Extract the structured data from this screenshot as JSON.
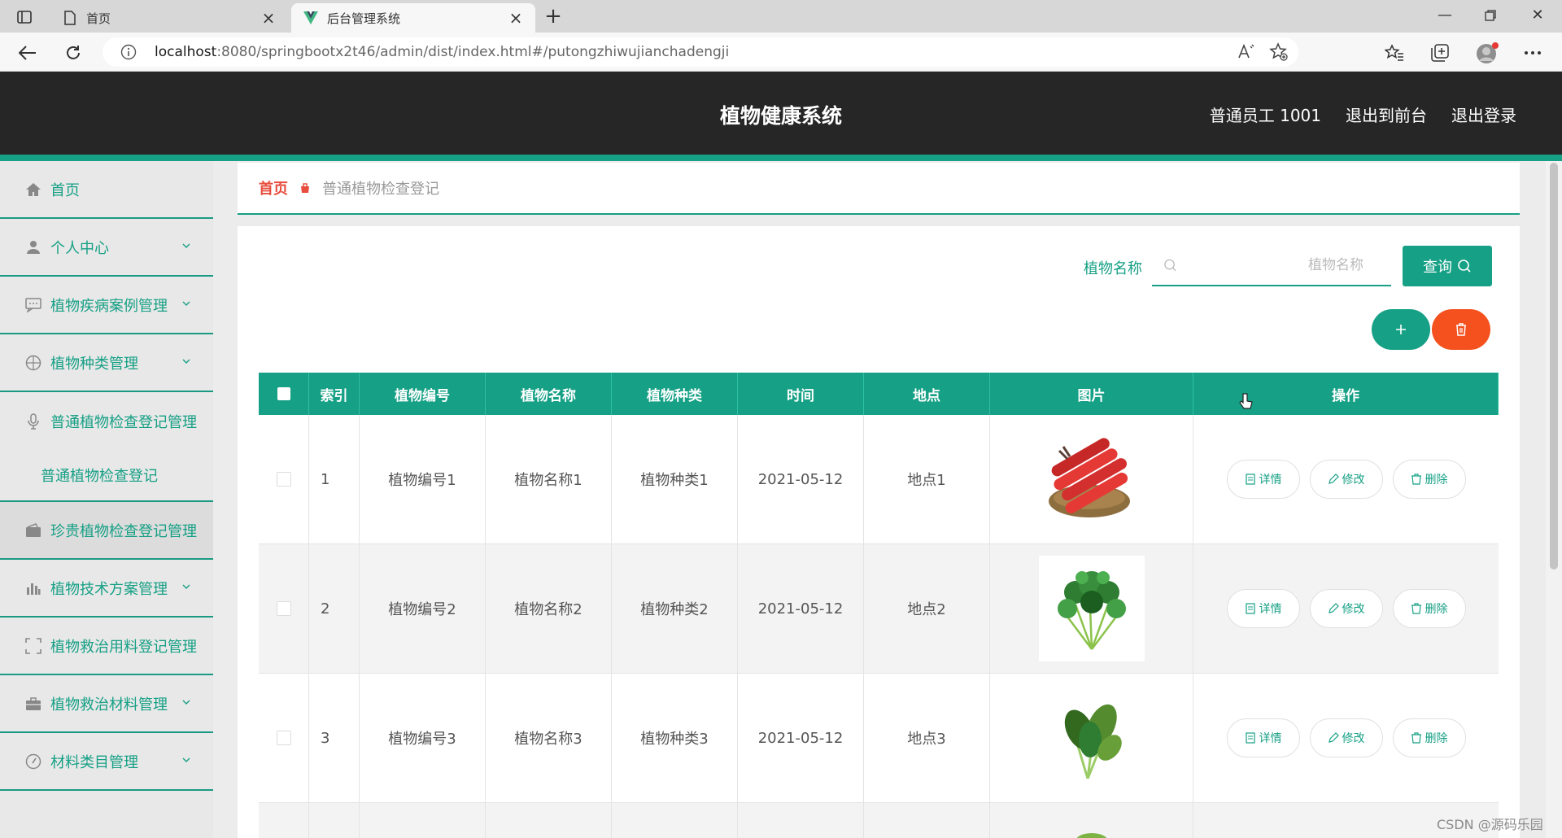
{
  "browser": {
    "tabs": [
      {
        "title": "首页",
        "active": false
      },
      {
        "title": "后台管理系统",
        "active": true
      }
    ],
    "url_host": "localhost",
    "url_path": ":8080/springbootx2t46/admin/dist/index.html#/putongzhiwujianchadengji"
  },
  "header": {
    "title": "植物健康系统",
    "user": "普通员工 1001",
    "to_front": "退出到前台",
    "logout": "退出登录"
  },
  "sidebar": {
    "items": [
      {
        "label": "首页",
        "icon": "home-icon"
      },
      {
        "label": "个人中心",
        "icon": "user-icon"
      },
      {
        "label": "植物疾病案例管理",
        "icon": "message-icon"
      },
      {
        "label": "植物种类管理",
        "icon": "compass-icon"
      },
      {
        "label": "普通植物检查登记管理",
        "icon": "mic-icon",
        "submenu": "普通植物检查登记"
      },
      {
        "label": "珍贵植物检查登记管理",
        "icon": "wallet-icon"
      },
      {
        "label": "植物技术方案管理",
        "icon": "chart-icon"
      },
      {
        "label": "植物救治用料登记管理",
        "icon": "frame-icon"
      },
      {
        "label": "植物救治材料管理",
        "icon": "briefcase-icon"
      },
      {
        "label": "材料类目管理",
        "icon": "clock-icon"
      }
    ]
  },
  "breadcrumb": {
    "home": "首页",
    "current": "普通植物检查登记"
  },
  "search": {
    "label": "植物名称",
    "placeholder": "植物名称",
    "query_label": "查询"
  },
  "table": {
    "headers": [
      "索引",
      "植物编号",
      "植物名称",
      "植物种类",
      "时间",
      "地点",
      "图片",
      "操作"
    ],
    "rows": [
      {
        "index": "1",
        "code": "植物编号1",
        "name": "植物名称1",
        "kind": "植物种类1",
        "date": "2021-05-12",
        "place": "地点1",
        "image": "carrots"
      },
      {
        "index": "2",
        "code": "植物编号2",
        "name": "植物名称2",
        "kind": "植物种类2",
        "date": "2021-05-12",
        "place": "地点2",
        "image": "coriander"
      },
      {
        "index": "3",
        "code": "植物编号3",
        "name": "植物名称3",
        "kind": "植物种类3",
        "date": "2021-05-12",
        "place": "地点3",
        "image": "spinach"
      }
    ],
    "actions": {
      "detail": "详情",
      "edit": "修改",
      "delete": "删除"
    }
  },
  "colors": {
    "accent": "#16a085",
    "danger": "#f4511e",
    "header_bg": "#262626"
  },
  "watermark": "CSDN @源码乐园"
}
